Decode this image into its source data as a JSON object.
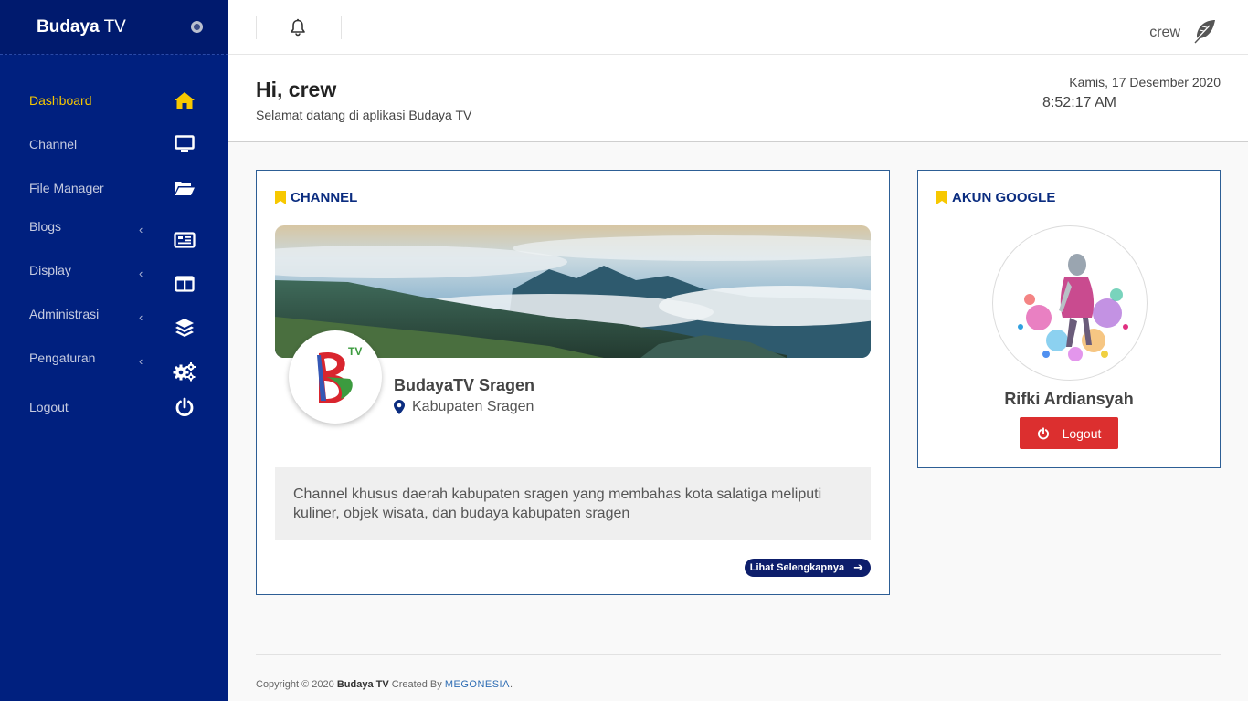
{
  "sidebar": {
    "brand_bold": "Budaya",
    "brand_light": " TV",
    "items": [
      {
        "label": "Dashboard",
        "icon": "home-icon",
        "active": true,
        "submenu": false
      },
      {
        "label": "Channel",
        "icon": "monitor-icon",
        "active": false,
        "submenu": false
      },
      {
        "label": "File Manager",
        "icon": "folder-open-icon",
        "active": false,
        "submenu": false
      },
      {
        "label": "Blogs",
        "icon": "newspaper-icon",
        "active": false,
        "submenu": true
      },
      {
        "label": "Display",
        "icon": "columns-icon",
        "active": false,
        "submenu": true
      },
      {
        "label": "Administrasi",
        "icon": "layers-icon",
        "active": false,
        "submenu": true
      },
      {
        "label": "Pengaturan",
        "icon": "cogs-icon",
        "active": false,
        "submenu": true
      },
      {
        "label": "Logout",
        "icon": "power-icon",
        "active": false,
        "submenu": false
      }
    ],
    "chevron": "‹"
  },
  "topbar": {
    "username": "crew",
    "icons": [
      "bell-icon",
      "feather-icon"
    ]
  },
  "header": {
    "greeting": "Hi, crew",
    "subtitle": "Selamat datang di aplikasi Budaya TV",
    "date": "Kamis, 17 Desember 2020",
    "time": "8:52:17 AM"
  },
  "channel_card": {
    "title": "CHANNEL",
    "channel_name": "BudayaTV Sragen",
    "location": "Kabupaten Sragen",
    "description": "Channel khusus daerah kabupaten sragen yang membahas kota salatiga meliputi kuliner, objek wisata, dan budaya kabupaten sragen",
    "more_label": "Lihat Selengkapnya",
    "logo_badge": "TV"
  },
  "google_card": {
    "title": "AKUN GOOGLE",
    "name": "Rifki Ardiansyah",
    "logout_label": "Logout"
  },
  "footer": {
    "prefix": "Copyright © 2020 ",
    "brand": "Budaya TV",
    "middle": " Created By ",
    "company": "MEGONESIA",
    "suffix": "."
  },
  "colors": {
    "sidebar_bg": "#00207f",
    "active": "#f7c800",
    "card_border": "#2d5e95",
    "logout": "#dc2f2f",
    "title": "#0b2d80"
  }
}
